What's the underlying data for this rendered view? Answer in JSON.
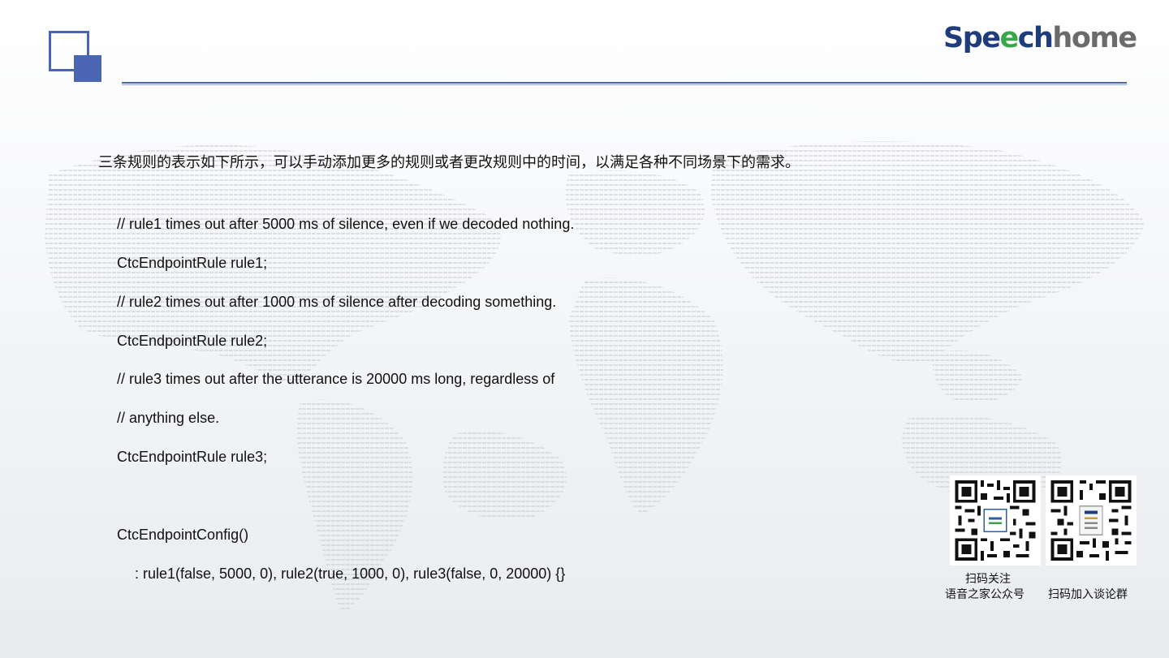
{
  "header": {
    "brand_primary": "Spe",
    "brand_accent": "e",
    "brand_rest": "ch",
    "brand_secondary": "home",
    "accent_color": "#4a66b3"
  },
  "content": {
    "intro": "三条规则的表示如下所示，可以手动添加更多的规则或者更改规则中的时间，以满足各种不同场景下的需求。",
    "code_lines": [
      "// rule1 times out after 5000 ms of silence, even if we decoded nothing.",
      "CtcEndpointRule rule1;",
      "// rule2 times out after 1000 ms of silence after decoding something.",
      "CtcEndpointRule rule2;",
      "// rule3 times out after the utterance is 20000 ms long, regardless of",
      "// anything else.",
      "CtcEndpointRule rule3;",
      "CtcEndpointConfig()",
      ": rule1(false, 5000, 0), rule2(true, 1000, 0), rule3(false, 0, 20000) {}"
    ]
  },
  "qr_codes": {
    "official_account": {
      "caption_line1": "扫码关注",
      "caption_line2": "语音之家公众号",
      "icon": "qr-code-icon"
    },
    "group": {
      "caption": "扫码加入谈论群",
      "icon": "qr-code-icon"
    }
  }
}
